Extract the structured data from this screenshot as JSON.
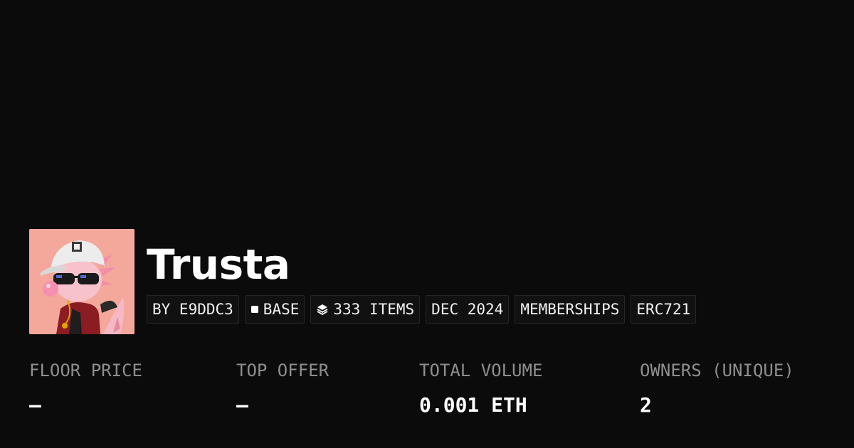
{
  "collection": {
    "name": "Trusta",
    "avatar_icon": "axolotl-cap-sunglasses-avatar",
    "avatar_bg": "#f4a89c"
  },
  "chips": [
    {
      "label": "BY E9DDC3",
      "icon": null
    },
    {
      "label": "BASE",
      "icon": "square-icon"
    },
    {
      "label": "333 ITEMS",
      "icon": "layers-icon"
    },
    {
      "label": "DEC 2024",
      "icon": null
    },
    {
      "label": "MEMBERSHIPS",
      "icon": null
    },
    {
      "label": "ERC721",
      "icon": null
    }
  ],
  "stats": [
    {
      "label": "FLOOR PRICE",
      "value": "–"
    },
    {
      "label": "TOP OFFER",
      "value": "–"
    },
    {
      "label": "TOTAL VOLUME",
      "value": "0.001 ETH"
    },
    {
      "label": "OWNERS (UNIQUE)",
      "value": "2"
    }
  ],
  "colors": {
    "background": "#0b0b0b",
    "chip_bg": "#111111",
    "chip_border": "#262626",
    "label_gray": "#8e8e8e",
    "text": "#ffffff"
  }
}
